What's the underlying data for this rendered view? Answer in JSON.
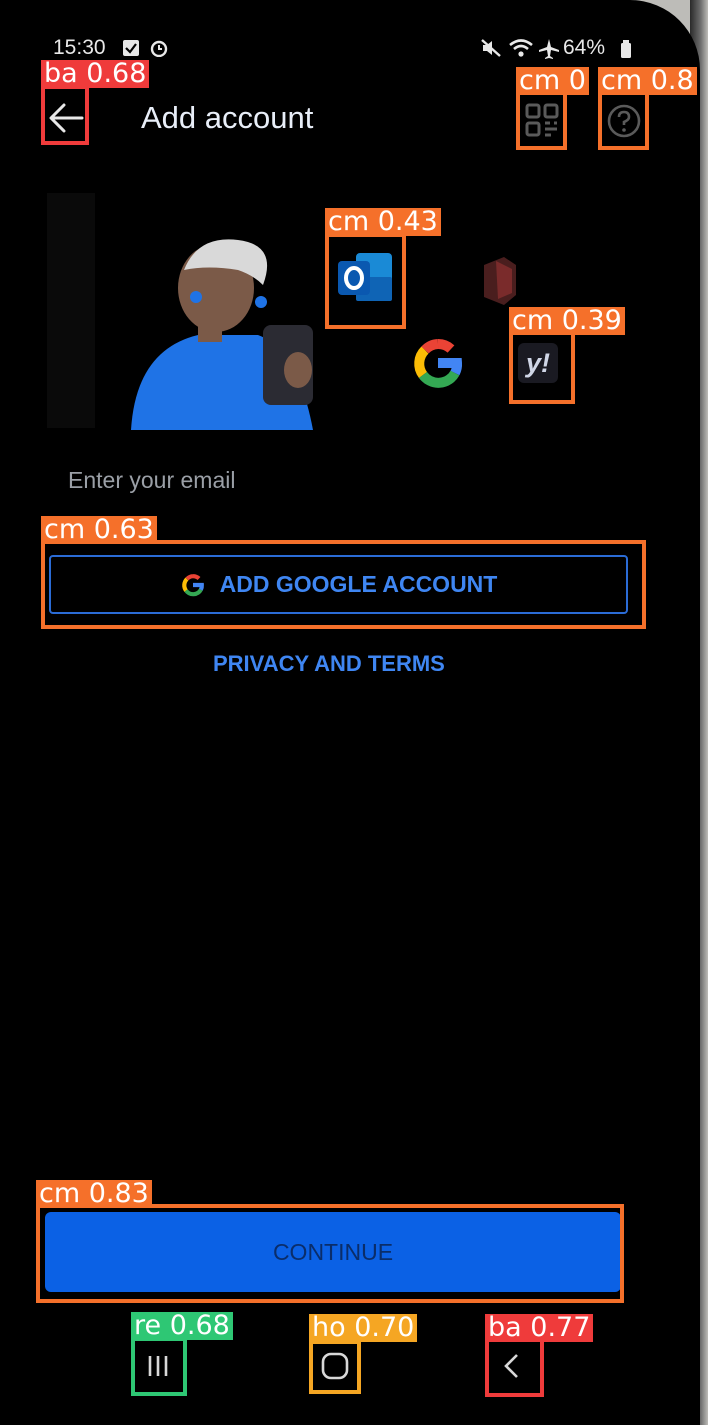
{
  "status_bar": {
    "time": "15:30",
    "battery": "64%"
  },
  "header": {
    "title": "Add account"
  },
  "illustration": {
    "providers": [
      "outlook",
      "office",
      "google",
      "yahoo"
    ],
    "yahoo_text": "y!"
  },
  "form": {
    "email_placeholder": "Enter your email",
    "google_button_label": "ADD GOOGLE ACCOUNT",
    "privacy_link": "PRIVACY AND TERMS",
    "continue_label": "CONTINUE"
  },
  "detections": [
    {
      "label": "ba 0.68"
    },
    {
      "label": "cm 0"
    },
    {
      "label": "cm 0.8"
    },
    {
      "label": "cm 0.43"
    },
    {
      "label": "cm 0.39"
    },
    {
      "label": "cm 0.63"
    },
    {
      "label": "cm 0.83"
    },
    {
      "label": "re 0.68"
    },
    {
      "label": "ho 0.70"
    },
    {
      "label": "ba 0.77"
    }
  ],
  "colors": {
    "accent": "#3f86f2",
    "continue_bg": "#0b61e5",
    "background": "#000000"
  }
}
